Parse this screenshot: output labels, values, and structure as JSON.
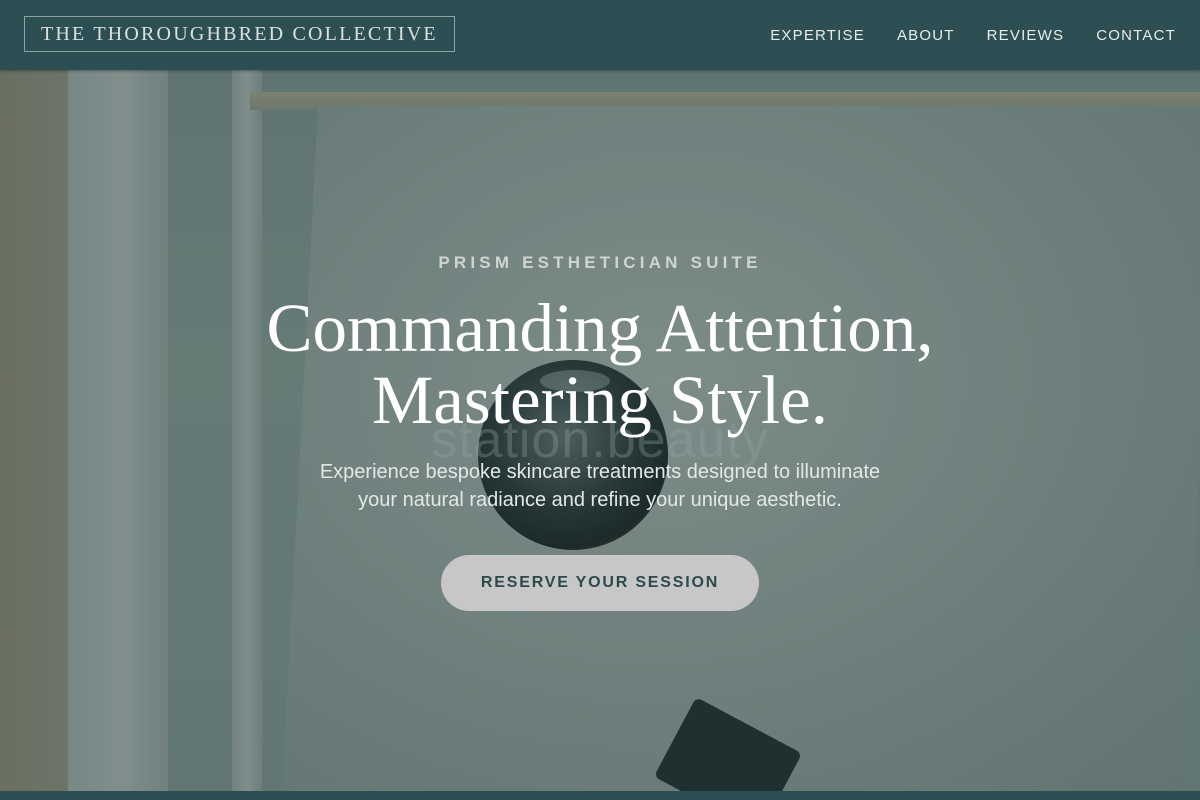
{
  "header": {
    "brand": "THE THOROUGHBRED COLLECTIVE",
    "nav": [
      "EXPERTISE",
      "ABOUT",
      "REVIEWS",
      "CONTACT"
    ]
  },
  "hero": {
    "eyebrow": "PRISM ESTHETICIAN SUITE",
    "headline_line1": "Commanding Attention,",
    "headline_line2": "Mastering Style.",
    "subtext_line1": "Experience bespoke skincare treatments designed to illuminate",
    "subtext_line2": "your natural radiance and refine your unique aesthetic.",
    "cta_label": "RESERVE YOUR SESSION",
    "background_watermark": "station.beauty"
  },
  "colors": {
    "header_bg": "#2d4f54",
    "cta_bg": "#c6c7c6",
    "cta_text": "#2c4a4e"
  }
}
